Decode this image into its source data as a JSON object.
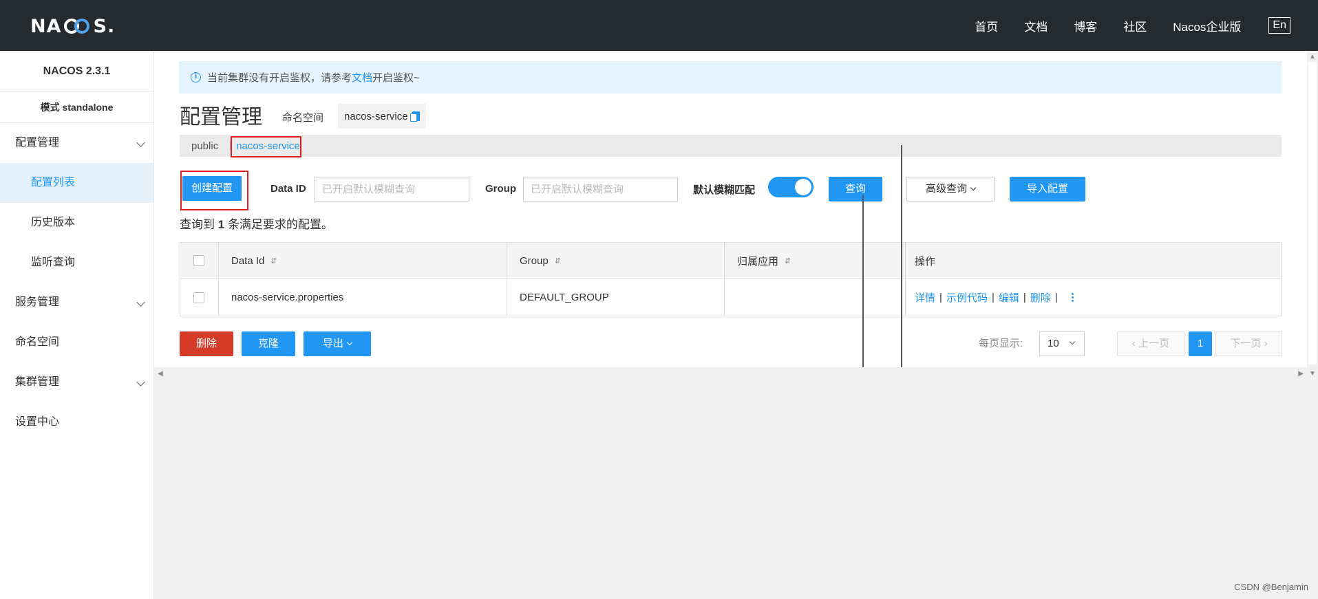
{
  "topbar": {
    "logo_left": "NA",
    "logo_right": "S.",
    "nav": [
      "首页",
      "文档",
      "博客",
      "社区",
      "Nacos企业版"
    ],
    "lang": "En"
  },
  "sidebar": {
    "version": "NACOS 2.3.1",
    "mode": "模式 standalone",
    "items": {
      "config_mgmt": "配置管理",
      "config_list": "配置列表",
      "history": "历史版本",
      "listener": "监听查询",
      "service_mgmt": "服务管理",
      "namespace": "命名空间",
      "cluster_mgmt": "集群管理",
      "settings": "设置中心"
    }
  },
  "notice": {
    "before": "当前集群没有开启鉴权，请参考",
    "link": "文档",
    "after": "开启鉴权~"
  },
  "header": {
    "title": "配置管理",
    "ns_label": "命名空间",
    "ns_value": "nacos-service"
  },
  "ns_tabs": [
    "public",
    "nacos-service"
  ],
  "toolbar": {
    "create": "创建配置",
    "dataid_label": "Data ID",
    "dataid_placeholder": "已开启默认模糊查询",
    "group_label": "Group",
    "group_placeholder": "已开启默认模糊查询",
    "fuzzy_label": "默认模糊匹配",
    "fuzzy_on": true,
    "query": "查询",
    "advanced": "高级查询",
    "import": "导入配置"
  },
  "result": {
    "prefix": "查询到",
    "count": "1",
    "suffix": "条满足要求的配置。"
  },
  "table": {
    "headers": [
      "Data Id",
      "Group",
      "归属应用",
      "操作"
    ],
    "rows": [
      {
        "data_id": "nacos-service.properties",
        "group": "DEFAULT_GROUP",
        "app": "",
        "ops": [
          "详情",
          "示例代码",
          "编辑",
          "删除"
        ]
      }
    ]
  },
  "bottom": {
    "delete": "删除",
    "clone": "克隆",
    "export": "导出"
  },
  "pagination": {
    "per_page_label": "每页显示:",
    "per_page": "10",
    "prev": "上一页",
    "current": "1",
    "next": "下一页"
  },
  "watermark": "CSDN @Benjamin",
  "colors": {
    "primary": "#2196f3",
    "danger": "#d43b29",
    "topbar": "#252a2f",
    "annotation": "#e02020"
  }
}
